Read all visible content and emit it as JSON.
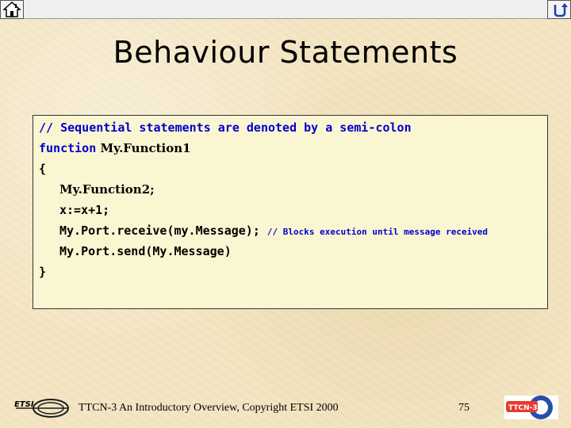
{
  "slide": {
    "title": "Behaviour Statements",
    "code": {
      "comment_line": "// Sequential statements are denoted by a semi-colon",
      "function_keyword": "function",
      "function_name": " My.Function1",
      "open_brace": "{",
      "stmt1": "My.Function2;",
      "stmt2": "x:=x+1;",
      "stmt3_code": "My.Port.receive(my.Message);",
      "stmt3_comment": "// Blocks execution until message received",
      "stmt4": "My.Port.send(My.Message)",
      "close_brace": "}"
    }
  },
  "footer": {
    "text": "TTCN-3 An Introductory Overview, Copyright ETSI 2000",
    "page_number": "75",
    "etsi_logo_text": "ETSI",
    "ttcn_logo_text": "TTCN-3"
  },
  "nav": {
    "home_icon": "home-icon",
    "back_icon": "return-arrow-icon"
  },
  "colors": {
    "background": "#f4e6c4",
    "code_box": "#fbf6d2",
    "keyword_blue": "#0000cc"
  }
}
